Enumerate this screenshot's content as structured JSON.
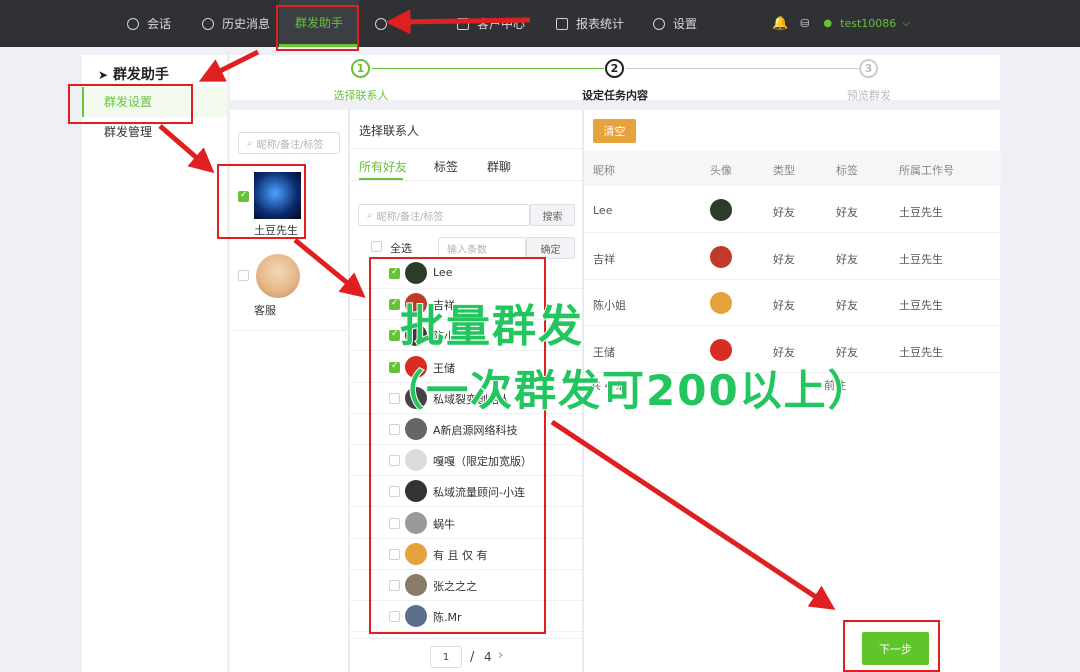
{
  "topnav": {
    "items": [
      {
        "label": "会话",
        "icon": "chat-icon"
      },
      {
        "label": "历史消息",
        "icon": "clock-icon"
      },
      {
        "label": "群发助手",
        "icon": "",
        "active": true
      },
      {
        "label": "客户中心",
        "icon": "user-icon"
      },
      {
        "label": "报表统计",
        "icon": "bar-chart-icon"
      },
      {
        "label": "设置",
        "icon": "gear-icon"
      }
    ],
    "username": "test10086"
  },
  "sidebar": {
    "title": "群发助手",
    "items": [
      {
        "label": "群发设置",
        "active": true
      },
      {
        "label": "群发管理",
        "active": false
      }
    ]
  },
  "steps": [
    {
      "num": "1",
      "label": "选择联系人",
      "state": "done"
    },
    {
      "num": "2",
      "label": "设定任务内容",
      "state": "current"
    },
    {
      "num": "3",
      "label": "预览群发",
      "state": "todo"
    }
  ],
  "accounts": {
    "search_placeholder": "昵称/备注/标签",
    "items": [
      {
        "name": "土豆先生",
        "checked": true
      },
      {
        "name": "客服",
        "checked": false
      }
    ]
  },
  "contacts": {
    "header": "选择联系人",
    "tabs": [
      "所有好友",
      "标签",
      "群聊"
    ],
    "search_placeholder": "昵称/备注/标签",
    "search_button": "搜索",
    "select_all": "全选",
    "count_placeholder": "输入条数",
    "confirm_button": "确定",
    "list": [
      {
        "name": "Lee",
        "checked": true,
        "color": "#2d3b2a"
      },
      {
        "name": "吉祥",
        "checked": true,
        "color": "#c0392b"
      },
      {
        "name": "陈小姐",
        "checked": true,
        "color": "#3a3a3a"
      },
      {
        "name": "王储",
        "checked": true,
        "color": "#d62d20"
      },
      {
        "name": "私域裂变创始人",
        "checked": false,
        "color": "#444"
      },
      {
        "name": "A新启源网络科技",
        "checked": false,
        "color": "#666"
      },
      {
        "name": "嘎嘎（限定加宽版）",
        "checked": false,
        "color": "#ddd"
      },
      {
        "name": "私域流量顾问-小连",
        "checked": false,
        "color": "#333"
      },
      {
        "name": "蜗牛",
        "checked": false,
        "color": "#999"
      },
      {
        "name": "有 且 仅 有",
        "checked": false,
        "color": "#e6a23c"
      },
      {
        "name": "张之之之",
        "checked": false,
        "color": "#8a7a6a"
      },
      {
        "name": "陈.Mr",
        "checked": false,
        "color": "#5b6f8a"
      }
    ],
    "pager": {
      "current": "1",
      "total": "4"
    }
  },
  "selected": {
    "clear_button": "清空",
    "columns": [
      "昵称",
      "头像",
      "类型",
      "标签",
      "所属工作号"
    ],
    "rows": [
      {
        "nick": "Lee",
        "type": "好友",
        "tag": "好友",
        "owner": "土豆先生",
        "color": "#2d3b2a"
      },
      {
        "nick": "吉祥",
        "type": "好友",
        "tag": "好友",
        "owner": "土豆先生",
        "color": "#c0392b"
      },
      {
        "nick": "陈小姐",
        "type": "好友",
        "tag": "好友",
        "owner": "土豆先生",
        "color": "#e6a23c"
      },
      {
        "nick": "王储",
        "type": "好友",
        "tag": "好友",
        "owner": "土豆先生",
        "color": "#d62d20"
      }
    ],
    "pager_info": "共 4 条",
    "pager_prev": "前往"
  },
  "next_button": "下一步",
  "overlay": {
    "line1": "批量群发",
    "line2": "（一次群发可200以上）"
  },
  "colors": {
    "accent": "#67c23a",
    "nav_bg": "#2f3135",
    "annotation_red": "#e02020",
    "overlay_green": "#22c55e",
    "clear_btn": "#e6a23c"
  }
}
